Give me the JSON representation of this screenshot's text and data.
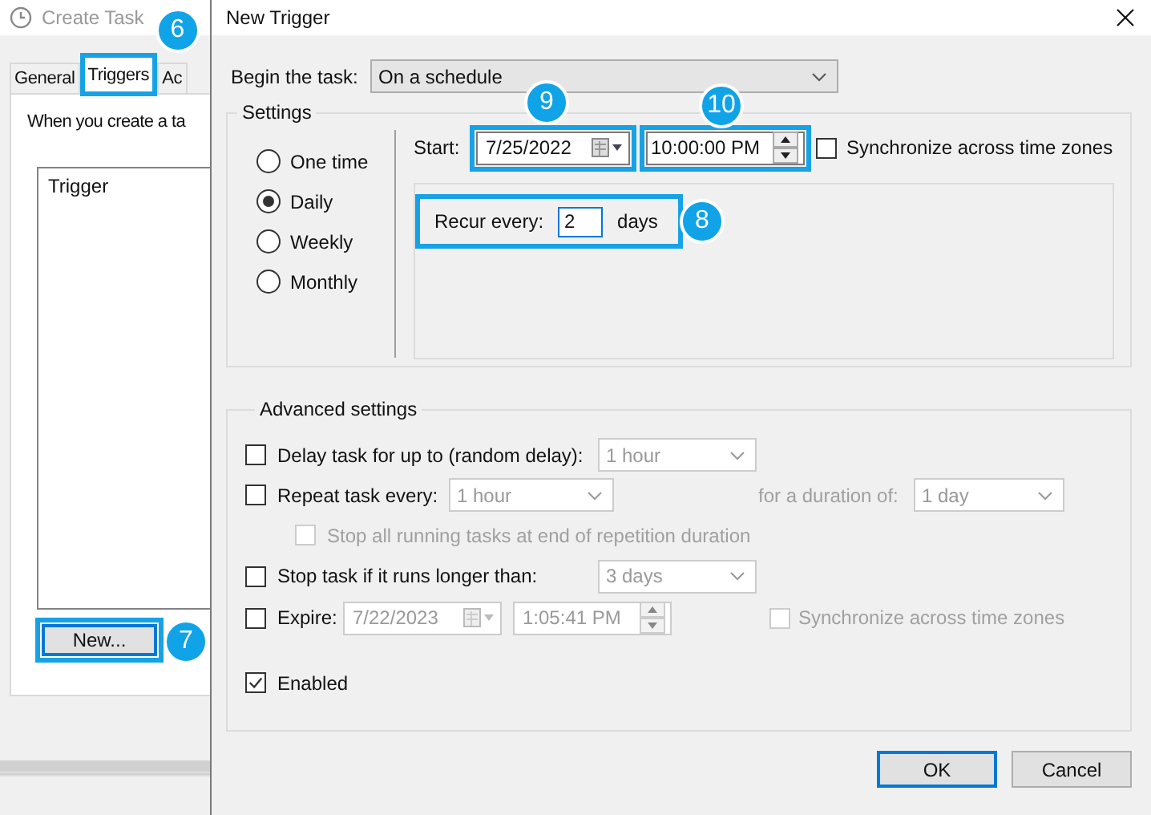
{
  "background_window": {
    "title": "Create Task",
    "tabs": [
      {
        "label": "General",
        "selected": false
      },
      {
        "label": "Triggers",
        "selected": true,
        "callout": "6"
      },
      {
        "label": "Ac",
        "selected": false
      }
    ],
    "description": "When you create a ta",
    "list_header": "Trigger",
    "new_button": {
      "label": "New...",
      "callout": "7"
    }
  },
  "dialog": {
    "title": "New Trigger",
    "begin": {
      "label": "Begin the task:",
      "value": "On a schedule"
    },
    "settings_title": "Settings",
    "schedules": [
      {
        "label": "One time",
        "selected": false
      },
      {
        "label": "Daily",
        "selected": true
      },
      {
        "label": "Weekly",
        "selected": false
      },
      {
        "label": "Monthly",
        "selected": false
      }
    ],
    "start": {
      "label": "Start:",
      "date": "7/25/2022",
      "date_callout": "9",
      "time": "10:00:00 PM",
      "time_callout": "10"
    },
    "sync": {
      "label": "Synchronize across time zones",
      "checked": false
    },
    "recur": {
      "label": "Recur every:",
      "value": "2",
      "unit": "days",
      "callout": "8"
    },
    "advanced_title": "Advanced settings",
    "delay": {
      "label": "Delay task for up to (random delay):",
      "checked": false,
      "value": "1 hour"
    },
    "repeat": {
      "label": "Repeat task every:",
      "checked": false,
      "value": "1 hour",
      "duration_label": "for a duration of:",
      "duration_value": "1 day"
    },
    "stop_running": {
      "label": "Stop all running tasks at end of repetition duration",
      "checked": false,
      "disabled": true
    },
    "stop_long": {
      "label": "Stop task if it runs longer than:",
      "checked": false,
      "value": "3 days"
    },
    "expire": {
      "label": "Expire:",
      "checked": false,
      "date": "7/22/2023",
      "time": "1:05:41 PM",
      "sync_label": "Synchronize across time zones",
      "sync_checked": false
    },
    "enabled": {
      "label": "Enabled",
      "checked": true
    },
    "buttons": [
      {
        "label": "OK",
        "default": true
      },
      {
        "label": "Cancel",
        "default": false
      }
    ]
  }
}
